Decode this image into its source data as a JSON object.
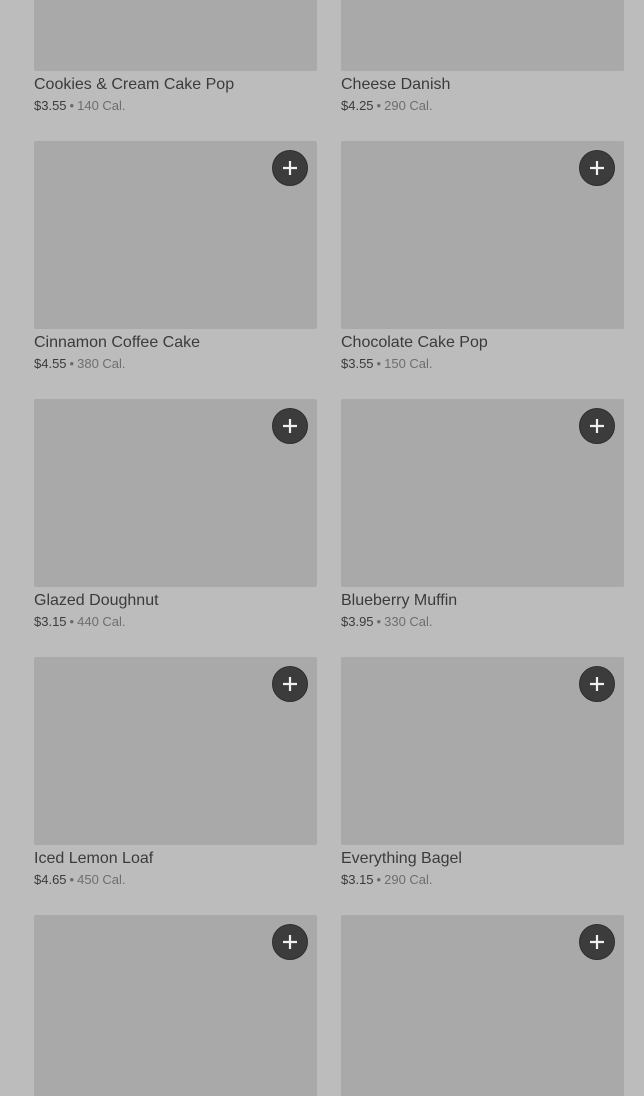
{
  "menu_items": [
    {
      "name": "Cookies & Cream Cake Pop",
      "price": "$3.55",
      "calories": "140 Cal."
    },
    {
      "name": "Cheese Danish",
      "price": "$4.25",
      "calories": "290 Cal."
    },
    {
      "name": "Cinnamon Coffee Cake",
      "price": "$4.55",
      "calories": "380 Cal."
    },
    {
      "name": "Chocolate Cake Pop",
      "price": "$3.55",
      "calories": "150 Cal."
    },
    {
      "name": "Glazed Doughnut",
      "price": "$3.15",
      "calories": "440 Cal."
    },
    {
      "name": "Blueberry Muffin",
      "price": "$3.95",
      "calories": "330 Cal."
    },
    {
      "name": "Iced Lemon Loaf",
      "price": "$4.65",
      "calories": "450 Cal."
    },
    {
      "name": "Everything Bagel",
      "price": "$3.15",
      "calories": "290 Cal."
    },
    {
      "name": "",
      "price": "",
      "calories": ""
    },
    {
      "name": "",
      "price": "",
      "calories": ""
    }
  ],
  "separator": "•",
  "add_icon": "plus-icon",
  "colors": {
    "background": "#bcbcbc",
    "image_placeholder": "#a9a9a9",
    "add_button": "#3c3c3c"
  }
}
